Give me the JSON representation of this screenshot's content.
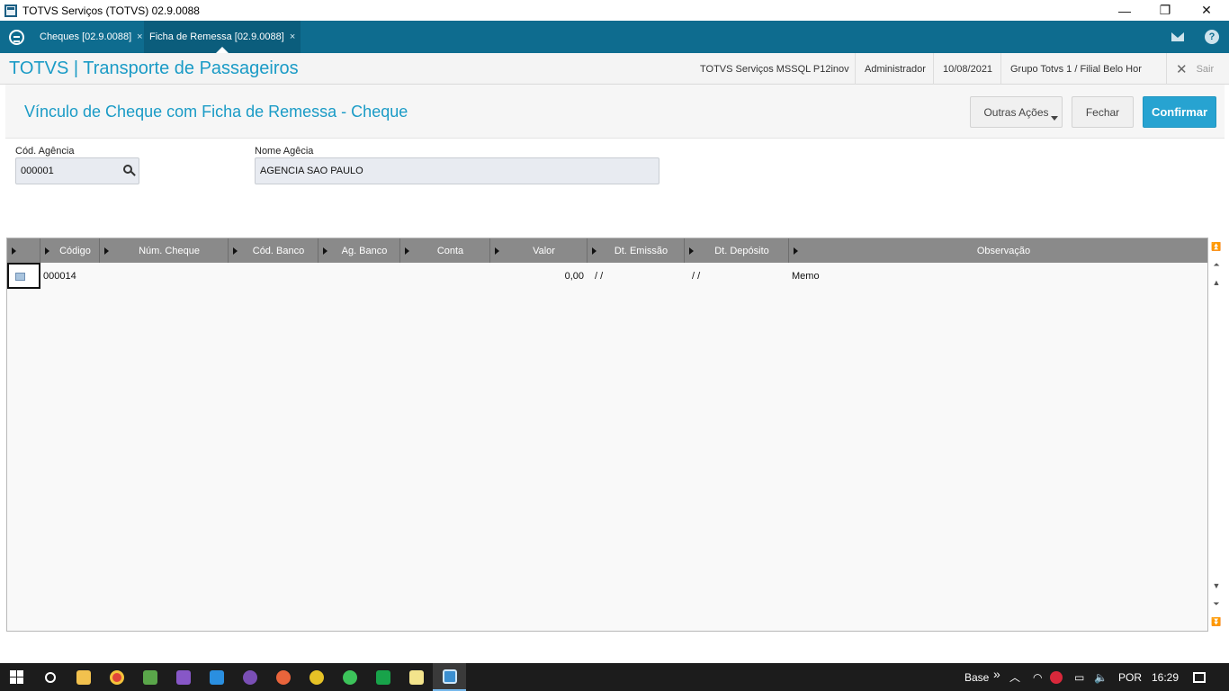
{
  "window": {
    "title": "TOTVS Serviços (TOTVS) 02.9.0088",
    "minimize": "—",
    "maximize": "❐",
    "close": "✕"
  },
  "tabs": [
    {
      "label": "Cheques [02.9.0088]",
      "close": "×"
    },
    {
      "label": "Ficha de Remessa [02.9.0088]",
      "close": "×"
    }
  ],
  "header": {
    "module_title": "TOTVS | Transporte de Passageiros",
    "environment": "TOTVS Serviços MSSQL P12inov",
    "user": "Administrador",
    "date": "10/08/2021",
    "branch": "Grupo Totvs 1 / Filial Belo Hor",
    "exit_label": "Sair"
  },
  "form": {
    "title": "Vínculo de Cheque com Ficha de Remessa - Cheque",
    "buttons": {
      "other_actions": "Outras Ações",
      "close": "Fechar",
      "confirm": "Confirmar"
    },
    "fields": {
      "agency_code_label": "Cód. Agência",
      "agency_code_value": "000001",
      "agency_name_label": "Nome Agêcia",
      "agency_name_value": "AGENCIA SAO PAULO"
    }
  },
  "grid": {
    "columns": [
      "Código",
      "Núm. Cheque",
      "Cód. Banco",
      "Ag. Banco",
      "Conta",
      "Valor",
      "Dt. Emissão",
      "Dt. Depósito",
      "Observação"
    ],
    "rows": [
      {
        "codigo": "000014",
        "num_cheque": "",
        "cod_banco": "",
        "ag_banco": "",
        "conta": "",
        "valor": "0,00",
        "dt_emissao": "/ /",
        "dt_deposito": "/ /",
        "observacao": "Memo"
      }
    ]
  },
  "taskbar": {
    "language": "Base",
    "more": "»",
    "locale": "POR",
    "time": "16:29"
  },
  "colors": {
    "accent": "#1a9bc6",
    "tabbar": "#0e6c8f",
    "confirm": "#27a3d1",
    "grid_header": "#8a8a8a"
  }
}
